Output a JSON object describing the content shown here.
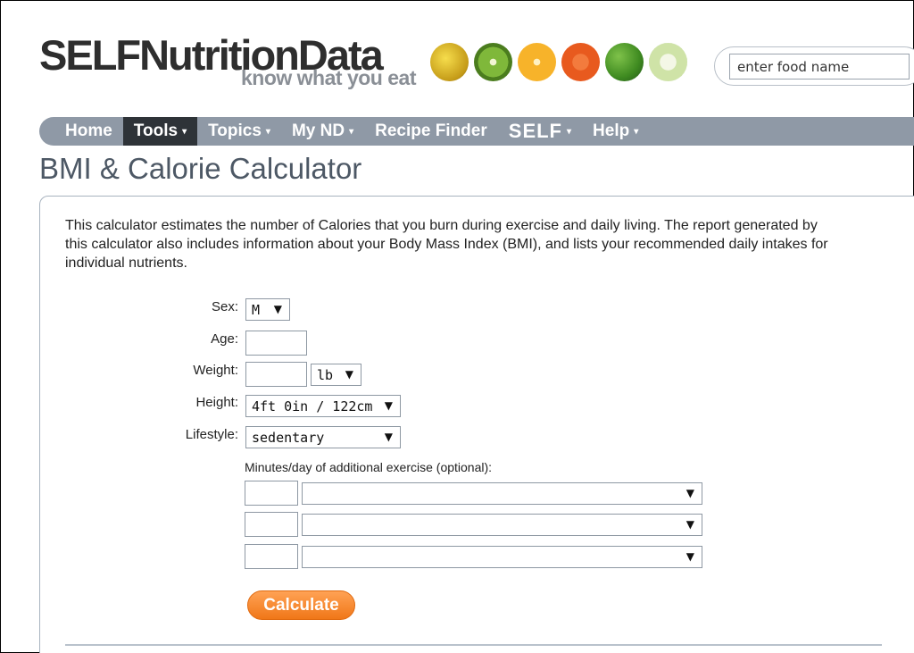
{
  "header": {
    "logo_text": "SELFNutritionData",
    "tagline": "know what you eat",
    "fruit_icons": [
      "banana-icon",
      "kiwi-icon",
      "orange-icon",
      "carrot-icon",
      "greens-icon",
      "cucumber-icon"
    ],
    "search": {
      "value": "enter food name"
    }
  },
  "nav": {
    "items": [
      {
        "label": "Home",
        "caret": false,
        "active": false
      },
      {
        "label": "Tools",
        "caret": true,
        "active": true
      },
      {
        "label": "Topics",
        "caret": true,
        "active": false
      },
      {
        "label": "My ND",
        "caret": true,
        "active": false
      },
      {
        "label": "Recipe Finder",
        "caret": false,
        "active": false
      },
      {
        "label": "SELF",
        "caret": true,
        "active": false
      },
      {
        "label": "Help",
        "caret": true,
        "active": false
      }
    ],
    "caret_glyph": "▾"
  },
  "page": {
    "title": "BMI & Calorie Calculator",
    "intro": "This calculator estimates the number of Calories that you burn during exercise and daily living. The report generated by this calculator also includes information about your Body Mass Index (BMI), and lists your recommended daily intakes for individual nutrients."
  },
  "form": {
    "sex": {
      "label": "Sex:",
      "value": "M"
    },
    "age": {
      "label": "Age:",
      "value": ""
    },
    "weight": {
      "label": "Weight:",
      "value": "",
      "unit": "lb"
    },
    "height": {
      "label": "Height:",
      "value": "4ft 0in / 122cm"
    },
    "lifestyle": {
      "label": "Lifestyle:",
      "value": "sedentary"
    },
    "exercise": {
      "label": "Minutes/day of additional exercise (optional):",
      "rows": [
        {
          "minutes": "",
          "activity": ""
        },
        {
          "minutes": "",
          "activity": ""
        },
        {
          "minutes": "",
          "activity": ""
        }
      ]
    },
    "submit_label": "Calculate"
  },
  "colors": {
    "nav_bg": "#8f99a6",
    "nav_active": "#2e3338",
    "button": "#f07718",
    "title": "#4d5865"
  }
}
